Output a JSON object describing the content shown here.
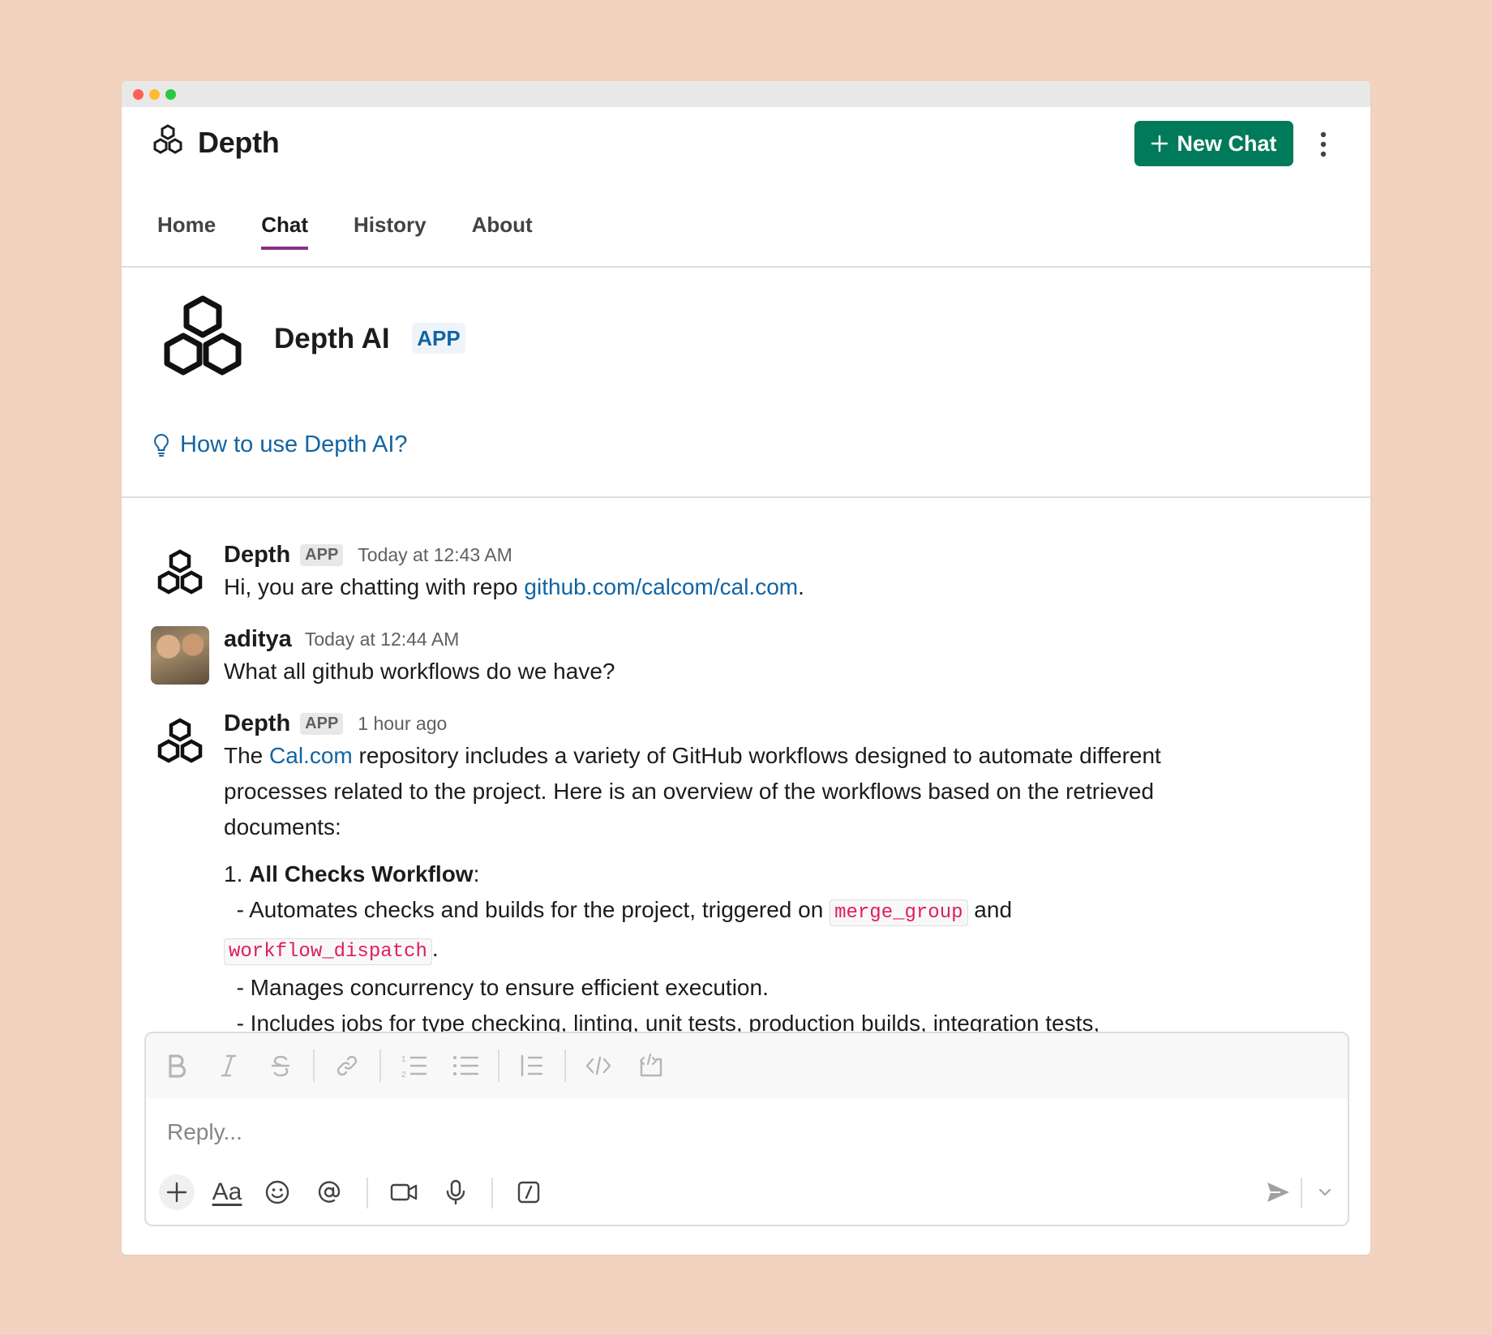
{
  "window": {
    "controls": [
      "close",
      "minimize",
      "zoom"
    ]
  },
  "header": {
    "app_title": "Depth",
    "new_chat_label": "New Chat",
    "tabs": [
      {
        "label": "Home",
        "active": false
      },
      {
        "label": "Chat",
        "active": true
      },
      {
        "label": "History",
        "active": false
      },
      {
        "label": "About",
        "active": false
      }
    ]
  },
  "intro": {
    "bot_name": "Depth AI",
    "badge": "APP",
    "help_link": "How to use Depth AI?"
  },
  "messages": [
    {
      "author": "Depth",
      "badge": "APP",
      "time": "Today at 12:43 AM",
      "text_before": "Hi, you are chatting with repo ",
      "link": "github.com/calcom/cal.com",
      "text_after": "."
    },
    {
      "author": "aditya",
      "time": "Today at 12:44 AM",
      "text": "What all github workflows do we have?"
    },
    {
      "author": "Depth",
      "badge": "APP",
      "time": "1 hour ago",
      "intro_before": "The ",
      "intro_link": "Cal.com",
      "intro_after": " repository includes a variety of GitHub workflows designed to automate different processes related to the project. Here is an overview of the workflows based on the retrieved documents:",
      "item_number": "1. ",
      "item_title": "All Checks Workflow",
      "item_colon": ":",
      "bullet1_before": "  - Automates checks and builds for the project, triggered on ",
      "bullet1_code1": "merge_group",
      "bullet1_mid": " and",
      "bullet1_code2": "workflow_dispatch",
      "bullet1_end": ".",
      "bullet2": "  - Manages concurrency to ensure efficient execution.",
      "bullet3": "  - Includes jobs for type checking, linting, unit tests, production builds, integration tests,"
    }
  ],
  "composer": {
    "placeholder": "Reply...",
    "format_tools": [
      "bold-icon",
      "italic-icon",
      "strikethrough-icon",
      "link-icon",
      "numbered-list-icon",
      "bulleted-list-icon",
      "blockquote-icon",
      "code-icon",
      "code-block-icon"
    ],
    "actions": [
      "plus-icon",
      "text-format-icon",
      "emoji-icon",
      "mention-icon",
      "video-icon",
      "microphone-icon",
      "slash-command-icon",
      "send-icon",
      "chevron-down-icon"
    ],
    "format_label": "Aa"
  },
  "colors": {
    "background": "#f2d3bf",
    "primary_button": "#007a5a",
    "link": "#1264a3",
    "tab_indicator": "#8a2e8a",
    "code_text": "#e01e5a"
  }
}
